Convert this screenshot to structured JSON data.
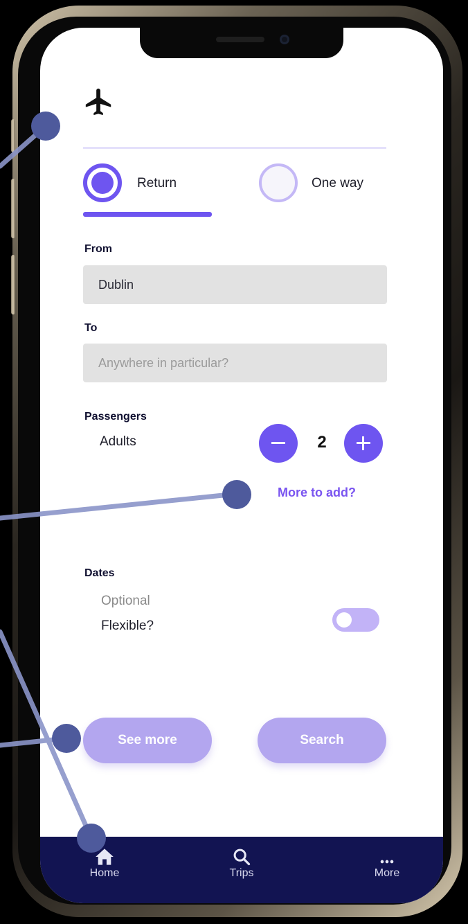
{
  "trip_type": {
    "return_label": "Return",
    "one_way_label": "One way"
  },
  "from": {
    "label": "From",
    "value": "Dublin"
  },
  "to": {
    "label": "To",
    "placeholder": "Anywhere in particular?"
  },
  "passengers": {
    "label": "Passengers",
    "adults_label": "Adults",
    "adults_count": "2",
    "more_link": "More to add?"
  },
  "dates": {
    "label": "Dates",
    "optional_text": "Optional",
    "flexible_label": "Flexible?",
    "flexible_on": false
  },
  "actions": {
    "see_more": "See more",
    "search": "Search"
  },
  "bottom_nav": {
    "home": "Home",
    "trips": "Trips",
    "more": "More"
  },
  "icons": {
    "header": "airplane-icon",
    "home": "home-icon",
    "trips": "search-icon",
    "more": "more-dots-icon"
  },
  "colors": {
    "accent": "#6e55f0",
    "accent_light": "#b3a6ef",
    "nav_background": "#121452",
    "annotation_dot": "#4e5a9c"
  }
}
